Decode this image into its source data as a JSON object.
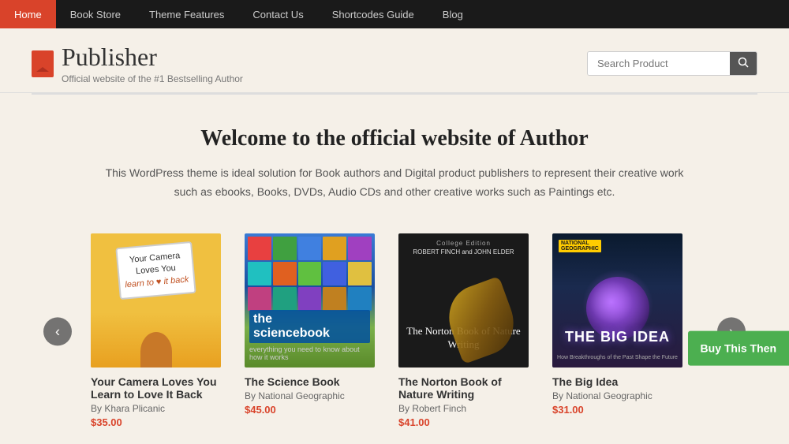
{
  "nav": {
    "items": [
      {
        "label": "Home",
        "active": true
      },
      {
        "label": "Book Store",
        "active": false
      },
      {
        "label": "Theme Features",
        "active": false
      },
      {
        "label": "Contact Us",
        "active": false
      },
      {
        "label": "Shortcodes Guide",
        "active": false
      },
      {
        "label": "Blog",
        "active": false
      }
    ]
  },
  "header": {
    "logo_text": "Publisher",
    "logo_sub": "Official website of the #1 Bestselling Author",
    "search_placeholder": "Search Product"
  },
  "welcome": {
    "title": "Welcome to the official website of Author",
    "description": "This WordPress theme is ideal solution for Book authors and Digital product publishers to represent their creative work such as ebooks, Books, DVDs, Audio CDs and other creative works such as Paintings etc."
  },
  "books": [
    {
      "title": "Your Camera Loves You Learn to Love It Back",
      "author": "By Khara Plicanic",
      "price": "$35.00",
      "cover_type": "camera"
    },
    {
      "title": "The Science Book",
      "author": "By National Geographic",
      "price": "$45.00",
      "cover_type": "science"
    },
    {
      "title": "The Norton Book of Nature Writing",
      "author": "By Robert Finch",
      "price": "$41.00",
      "cover_type": "norton"
    },
    {
      "title": "The Big Idea",
      "author": "By National Geographic",
      "price": "$31.00",
      "cover_type": "bigidea"
    }
  ],
  "carousel": {
    "prev_label": "‹",
    "next_label": "›"
  },
  "buy_btn": {
    "label": "Buy This Then"
  },
  "icons": {
    "search": "🔍",
    "book_logo": "📖"
  }
}
